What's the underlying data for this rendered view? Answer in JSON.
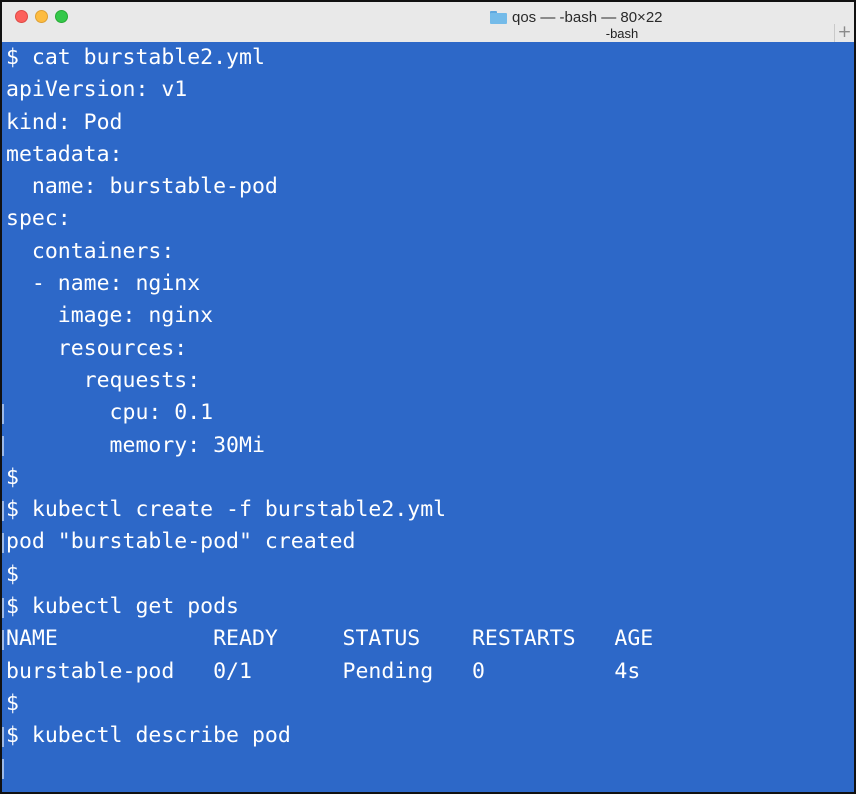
{
  "window": {
    "title": "qos — -bash — 80×22",
    "tab_label": "-bash",
    "new_tab_symbol": "+",
    "icons": {
      "close": "close-icon",
      "minimize": "minimize-icon",
      "zoom": "zoom-icon",
      "folder": "folder-icon"
    }
  },
  "colors": {
    "terminal_background": "#2d68c8",
    "terminal_text": "#ffffff",
    "titlebar": "#e9e9e9",
    "close": "#fc605c",
    "minimize": "#fdbc40",
    "zoom": "#34c84a"
  },
  "terminal": {
    "lines": [
      "$ cat burstable2.yml",
      "apiVersion: v1",
      "kind: Pod",
      "metadata:",
      "  name: burstable-pod",
      "spec:",
      "  containers:",
      "  - name: nginx",
      "    image: nginx",
      "    resources:",
      "      requests:",
      "        cpu: 0.1",
      "        memory: 30Mi",
      "$",
      "$ kubectl create -f burstable2.yml",
      "pod \"burstable-pod\" created",
      "$",
      "$ kubectl get pods",
      "NAME            READY     STATUS    RESTARTS   AGE",
      "burstable-pod   0/1       Pending   0          4s",
      "$",
      "$ kubectl describe pod"
    ]
  }
}
